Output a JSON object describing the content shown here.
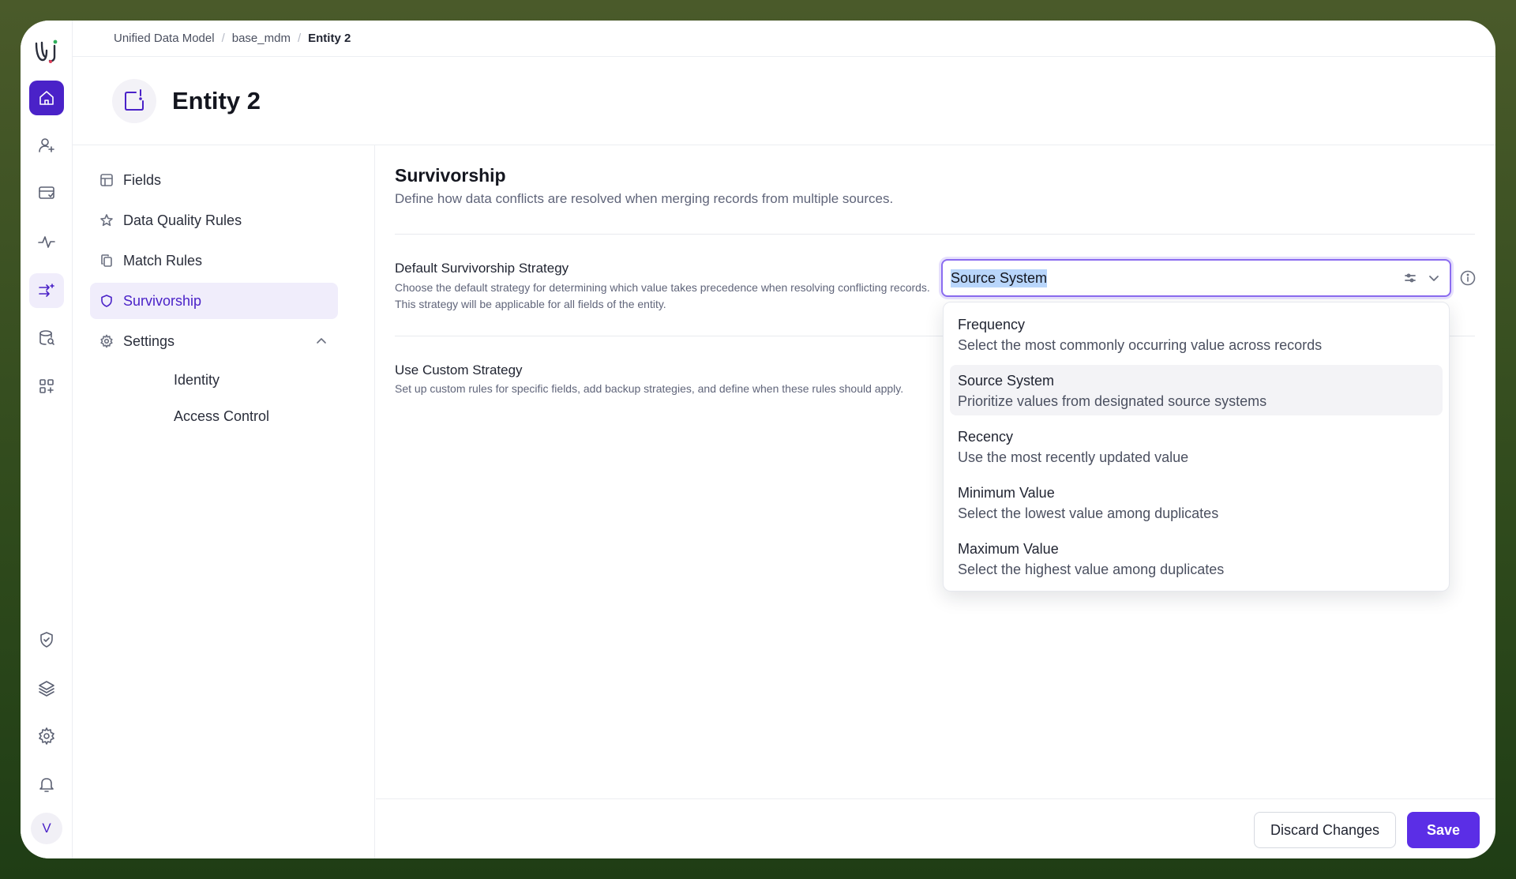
{
  "breadcrumb": {
    "items": [
      "Unified Data Model",
      "base_mdm"
    ],
    "current": "Entity 2"
  },
  "entity": {
    "title": "Entity 2"
  },
  "sidebar": {
    "items": [
      {
        "label": "Fields",
        "icon": "table-icon"
      },
      {
        "label": "Data Quality Rules",
        "icon": "star-icon"
      },
      {
        "label": "Match Rules",
        "icon": "copy-icon"
      },
      {
        "label": "Survivorship",
        "icon": "shield-icon"
      },
      {
        "label": "Settings",
        "icon": "gear-icon"
      }
    ],
    "settings_sub": [
      "Identity",
      "Access Control"
    ]
  },
  "section": {
    "title": "Survivorship",
    "subtitle": "Define how data conflicts are resolved when merging records from multiple sources."
  },
  "default_strategy": {
    "label": "Default Survivorship Strategy",
    "help": "Choose the default strategy for determining which value takes precedence when resolving conflicting records. This strategy will be applicable for all fields of the entity.",
    "selected": "Source System"
  },
  "custom_strategy": {
    "label": "Use Custom Strategy",
    "help": "Set up custom rules for specific fields, add backup strategies, and define when these rules should apply."
  },
  "options": [
    {
      "title": "Frequency",
      "desc": "Select the most commonly occurring value across records"
    },
    {
      "title": "Source System",
      "desc": "Prioritize values from designated source systems"
    },
    {
      "title": "Recency",
      "desc": "Use the most recently updated value"
    },
    {
      "title": "Minimum Value",
      "desc": "Select the lowest value among duplicates"
    },
    {
      "title": "Maximum Value",
      "desc": "Select the highest value among duplicates"
    }
  ],
  "footer": {
    "discard": "Discard Changes",
    "save": "Save"
  },
  "user": {
    "initial": "V"
  },
  "colors": {
    "accent": "#5b2ee6",
    "rail_active": "#4a22c8",
    "highlight": "#f0edfb"
  }
}
